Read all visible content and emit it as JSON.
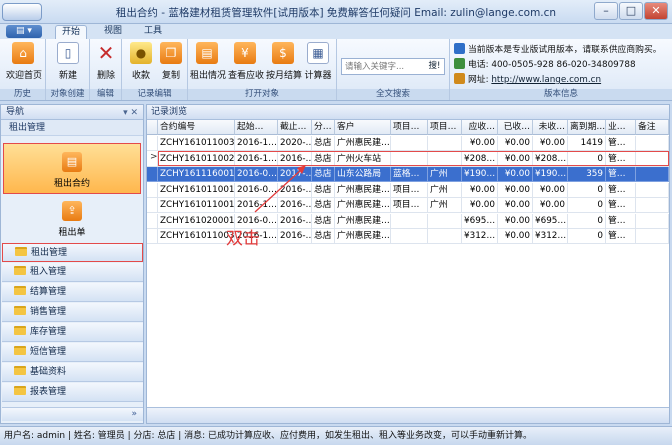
{
  "window": {
    "title": "租出合约 - 蓝格建材租赁管理软件[试用版本] 免费解答任何疑问 Email: zulin@lange.com.cn",
    "minimize": "–",
    "maximize": "□",
    "close": "✕"
  },
  "menu": {
    "file": "▤ ▾",
    "tabs": [
      "开始",
      "视图",
      "工具"
    ]
  },
  "ribbon": {
    "groups": [
      {
        "label": "历史",
        "buttons": [
          "欢迎首页"
        ]
      },
      {
        "label": "对象创建",
        "buttons": [
          "新建"
        ]
      },
      {
        "label": "编辑",
        "buttons": [
          "删除"
        ]
      },
      {
        "label": "记录编辑",
        "buttons": [
          "收款",
          "复制"
        ]
      },
      {
        "label": "打开对象",
        "buttons": [
          "租出情况",
          "查看应收",
          "按月结算",
          "计算器"
        ]
      },
      {
        "label": "全文搜索",
        "buttons": []
      },
      {
        "label": "版本信息",
        "buttons": []
      }
    ],
    "search": {
      "placeholder": "请输入关键字...",
      "button": "搜!"
    },
    "version_info": {
      "notice": "当前版本是专业版试用版本，请联系供应商购买。",
      "phone": "电话:  400-0505-928  86-020-34809788",
      "website_label": "网址:",
      "website": "http://www.lange.com.cn"
    }
  },
  "nav": {
    "header": "导航",
    "pins": "▾ ✕",
    "section": "租出管理",
    "big_items": [
      "租出合约",
      "租出单"
    ],
    "folders": [
      "租出管理",
      "租入管理",
      "结算管理",
      "销售管理",
      "库存管理",
      "短信管理",
      "基础资料",
      "报表管理"
    ],
    "bottom": "»"
  },
  "main": {
    "header": "记录浏览",
    "columns": [
      "合约编号",
      "起始…",
      "截止…",
      "分…",
      "客户",
      "项目…",
      "项目…",
      "应收…",
      "已收…",
      "未收…",
      "离到期…",
      "业…",
      "备注"
    ],
    "rows": [
      [
        "ZCHY161011003x1",
        "2016-1…",
        "2020-…",
        "总店",
        "广州惠民建…",
        "",
        "",
        "¥0.00",
        "¥0.00",
        "¥0.00",
        "1419",
        "管…",
        ""
      ],
      [
        "ZCHY161011002",
        "2016-1…",
        "2016-…",
        "总店",
        "广州火车站",
        "",
        "",
        "¥208…",
        "¥0.00",
        "¥208…",
        "0",
        "管…",
        ""
      ],
      [
        "ZCHY161116001",
        "2016-0…",
        "2017-…",
        "总店",
        "山东公路局",
        "蓝格…",
        "广州",
        "¥190…",
        "¥0.00",
        "¥190…",
        "359",
        "管…",
        ""
      ],
      [
        "ZCHY161011001",
        "2016-0…",
        "2016-…",
        "总店",
        "广州惠民建…",
        "项目…",
        "广州",
        "¥0.00",
        "¥0.00",
        "¥0.00",
        "0",
        "管…",
        ""
      ],
      [
        "ZCHY161011001x1",
        "2016-1…",
        "2016-…",
        "总店",
        "广州惠民建…",
        "项目…",
        "广州",
        "¥0.00",
        "¥0.00",
        "¥0.00",
        "0",
        "管…",
        ""
      ],
      [
        "ZCHY161020001",
        "2016-0…",
        "2016-…",
        "总店",
        "广州惠民建…",
        "",
        "",
        "¥695…",
        "¥0.00",
        "¥695…",
        "0",
        "管…",
        ""
      ],
      [
        "ZCHY161011003",
        "2016-1…",
        "2016-…",
        "总店",
        "广州惠民建…",
        "",
        "",
        "¥312…",
        "¥0.00",
        "¥312…",
        "0",
        "管…",
        ""
      ]
    ],
    "row_indicator": ">",
    "annotation": "双击"
  },
  "status_bar": "用户名: admin | 姓名: 管理员 | 分店: 总店 | 消息: 已成功计算应收、应付费用，如发生租出、租入等业务改变，可以手动重新计算。",
  "colors": {
    "accent": "#3b6fce",
    "highlight_border": "#e34a4a",
    "annotation": "#e23b3b",
    "icon_orange": "#e87b12"
  },
  "icons": [
    "home-icon",
    "new-doc-icon",
    "delete-icon",
    "coins-icon",
    "copy-icon",
    "chart-icon",
    "receivable-icon",
    "monthly-icon",
    "calculator-icon",
    "folder-icon"
  ]
}
